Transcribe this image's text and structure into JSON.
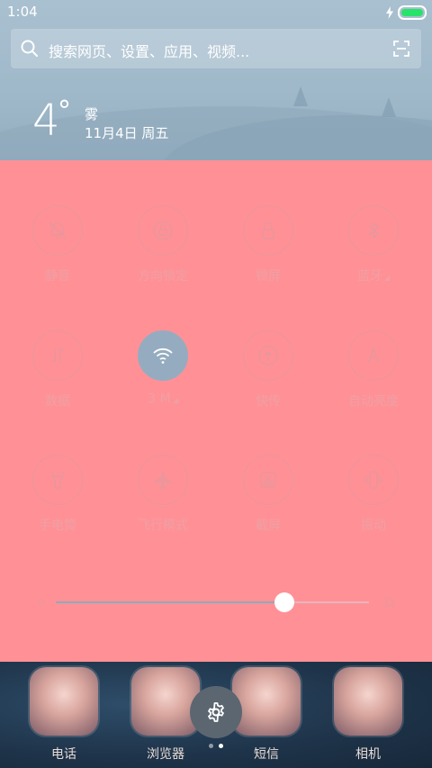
{
  "status_bar": {
    "time": "1:04",
    "battery_color": "#27e36a"
  },
  "search": {
    "placeholder": "搜索网页、设置、应用、视频...",
    "icon": "search-icon",
    "scan_icon": "scan-icon"
  },
  "weather": {
    "temperature": "4",
    "degree": "°",
    "condition": "雾",
    "date": "11月4日 周五"
  },
  "panel": {
    "background": "#ff9196",
    "tiles": [
      {
        "label": "静音",
        "icon": "mute-bell-icon",
        "active": false
      },
      {
        "label": "方向锁定",
        "icon": "rotation-lock-icon",
        "active": false
      },
      {
        "label": "锁屏",
        "icon": "lock-icon",
        "active": false
      },
      {
        "label": "蓝牙",
        "icon": "bluetooth-icon",
        "active": false
      },
      {
        "label": "数据",
        "icon": "data-arrows-icon",
        "active": false
      },
      {
        "label": "3  M",
        "icon": "wifi-icon",
        "active": true
      },
      {
        "label": "快传",
        "icon": "quick-transfer-icon",
        "active": false
      },
      {
        "label": "自动亮度",
        "icon": "auto-brightness-icon",
        "active": false
      },
      {
        "label": "手电筒",
        "icon": "flashlight-icon",
        "active": false
      },
      {
        "label": "飞行模式",
        "icon": "airplane-icon",
        "active": false
      },
      {
        "label": "截屏",
        "icon": "screenshot-icon",
        "active": false
      },
      {
        "label": "振动",
        "icon": "vibrate-icon",
        "active": false
      }
    ],
    "brightness_level": 0.73
  },
  "dock": {
    "apps": [
      {
        "label": "电话"
      },
      {
        "label": "浏览器"
      },
      {
        "label": "短信"
      },
      {
        "label": "相机"
      }
    ],
    "page_count": 2,
    "current_page": 2
  }
}
